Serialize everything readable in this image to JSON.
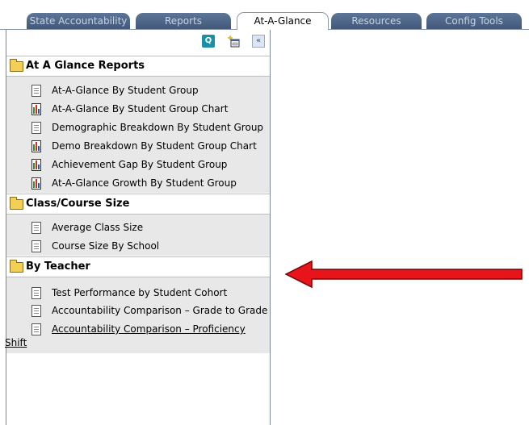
{
  "tabs": [
    {
      "label": "State Accountability"
    },
    {
      "label": "Reports"
    },
    {
      "label": "At-A-Glance",
      "active": true
    },
    {
      "label": "Resources"
    },
    {
      "label": "Config Tools"
    }
  ],
  "toolbar": {
    "q_label": "Q",
    "collapse_label": "«"
  },
  "sections": [
    {
      "title": "At A Glance Reports",
      "items": [
        {
          "label": "At-A-Glance By Student Group",
          "icon": "document-icon"
        },
        {
          "label": "At-A-Glance By Student Group Chart",
          "icon": "chart-icon"
        },
        {
          "label": "Demographic Breakdown By Student Group",
          "icon": "document-icon"
        },
        {
          "label": "Demo Breakdown By Student Group Chart",
          "icon": "chart-icon"
        },
        {
          "label": "Achievement Gap By Student Group",
          "icon": "chart-icon"
        },
        {
          "label": "At-A-Glance Growth By Student Group",
          "icon": "chart-icon"
        }
      ]
    },
    {
      "title": "Class/Course Size",
      "items": [
        {
          "label": "Average Class Size",
          "icon": "document-icon"
        },
        {
          "label": "Course Size By School",
          "icon": "document-icon"
        }
      ]
    },
    {
      "title": "By Teacher",
      "items": [
        {
          "label": "Test Performance by Student Cohort",
          "icon": "document-icon"
        },
        {
          "label": "Accountability Comparison – Grade to Grade",
          "icon": "document-icon"
        },
        {
          "label": "Accountability Comparison – Proficiency",
          "icon": "document-icon"
        }
      ]
    }
  ],
  "shift_text": "Shift",
  "colors": {
    "tab_bg": "#4d6587",
    "section_bg": "#e8e8e8",
    "arrow": "#e8141b"
  }
}
